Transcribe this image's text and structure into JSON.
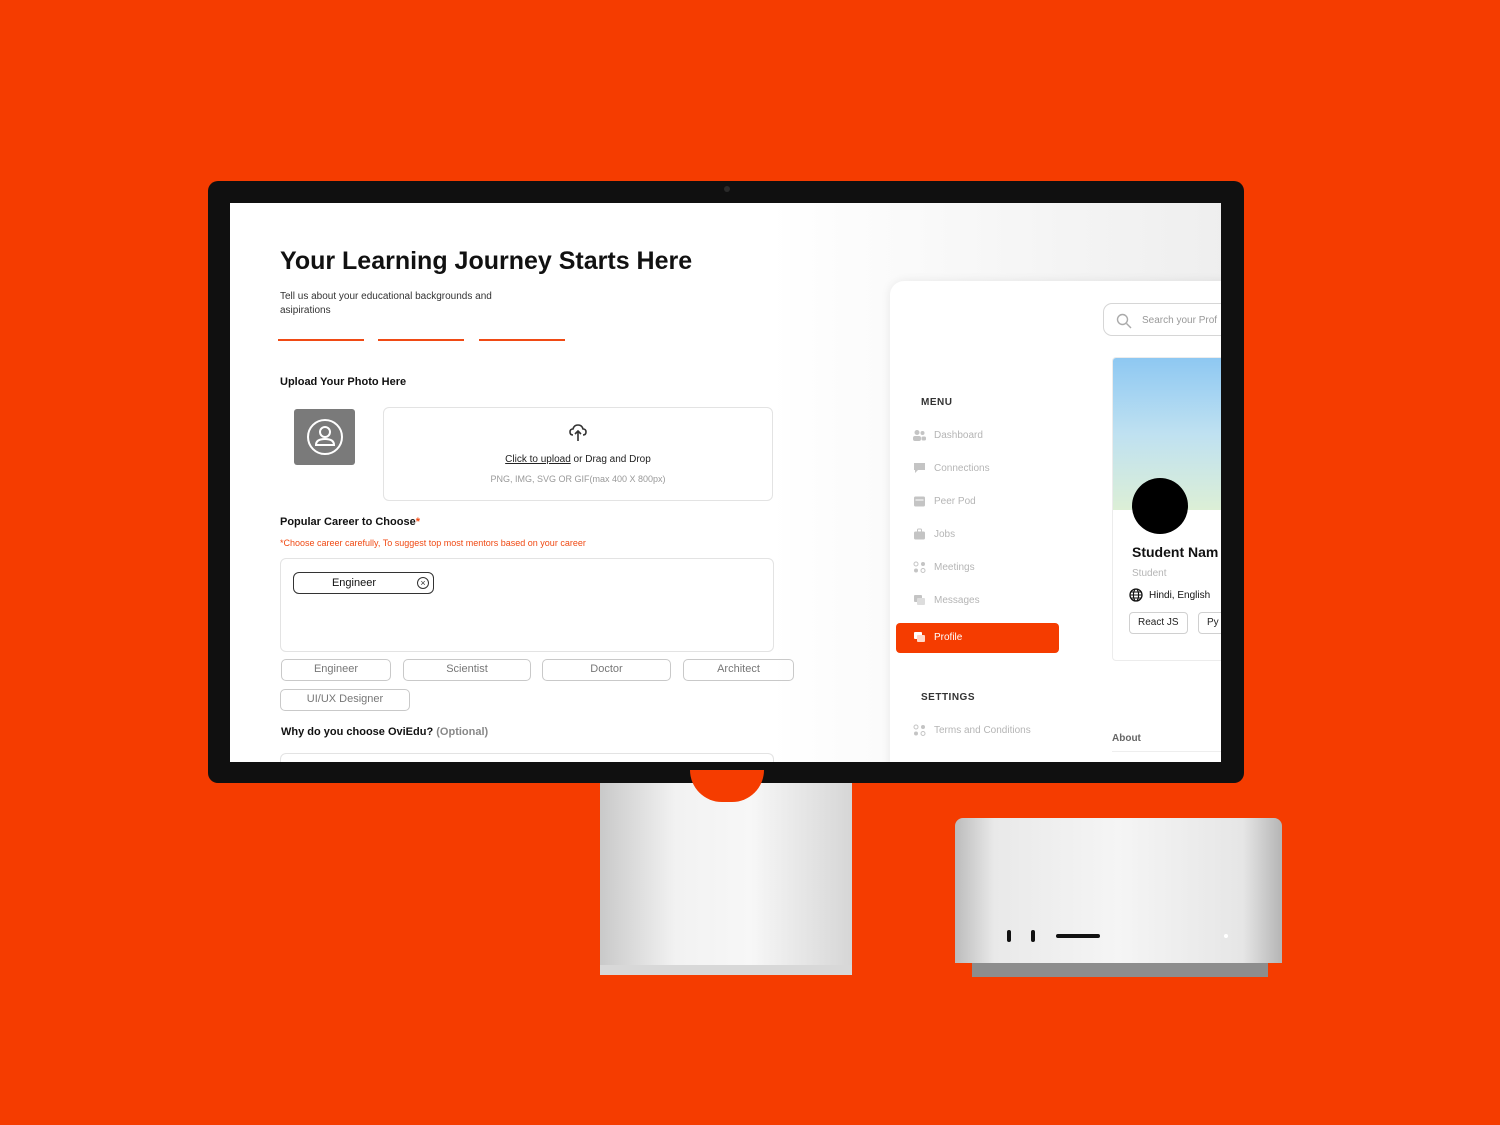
{
  "form": {
    "title": "Your Learning Journey Starts Here",
    "subtitle": "Tell us about your educational backgrounds and asipirations",
    "upload": {
      "label": "Upload Your Photo Here",
      "link": "Click to upload",
      "text": "or Drag and Drop",
      "hint": "PNG, IMG, SVG OR GIF(max 400 X 800px)"
    },
    "career": {
      "label": "Popular Career to Choose",
      "required_mark": "*",
      "note": "*Choose career carefully, To suggest top most mentors based on your career",
      "selected": "Engineer",
      "remove_icon": "close-circle-icon",
      "options": [
        "Engineer",
        "Scientist",
        "Doctor",
        "Architect",
        "UI/UX Designer"
      ]
    },
    "why": {
      "label": "Why do you choose OviEdu?",
      "optional": "(Optional)"
    }
  },
  "dashboard": {
    "search_placeholder": "Search your Prof",
    "menu_heading": "MENU",
    "menu": [
      {
        "label": "Dashboard",
        "icon": "users-icon"
      },
      {
        "label": "Connections",
        "icon": "chat-icon"
      },
      {
        "label": "Peer Pod",
        "icon": "calendar-icon"
      },
      {
        "label": "Jobs",
        "icon": "briefcase-icon"
      },
      {
        "label": "Meetings",
        "icon": "meetings-icon"
      },
      {
        "label": "Messages",
        "icon": "messages-icon"
      },
      {
        "label": "Profile",
        "icon": "profile-icon",
        "active": true
      }
    ],
    "settings_heading": "SETTINGS",
    "settings": [
      {
        "label": "Terms and Conditions",
        "icon": "terms-icon"
      }
    ],
    "profile": {
      "name": "Student Nam",
      "role": "Student",
      "languages": "Hindi, English",
      "skills": [
        "React JS",
        "Py"
      ]
    },
    "about_label": "About"
  },
  "colors": {
    "background": "#f53c00",
    "accent": "#f04a14",
    "active_nav": "#f53c00"
  }
}
